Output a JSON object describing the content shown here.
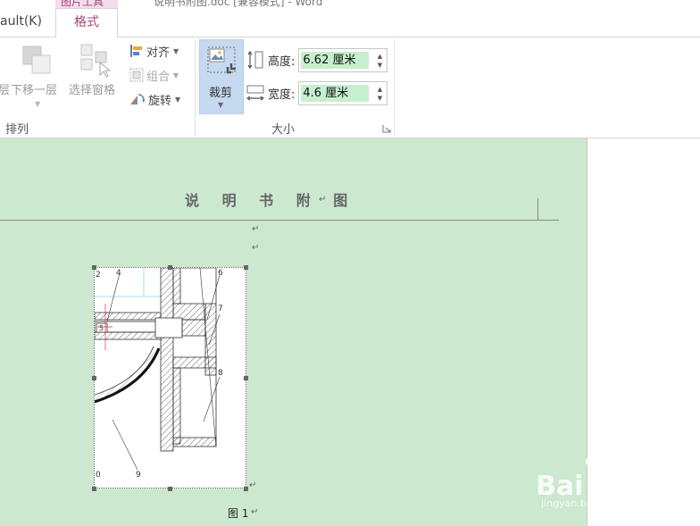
{
  "ribbon": {
    "context_tab_label": "图片工具",
    "title_fragment": "说明书附图.doc [兼容模式] - Word",
    "tabs": [
      {
        "label": "ault(K)"
      },
      {
        "label": "格式"
      }
    ],
    "arrange": {
      "group_label": "排列",
      "bring_forward_label": "层",
      "send_backward_label": "下移一层",
      "selection_pane_label": "选择窗格",
      "align_label": "对齐",
      "group_objects_label": "组合",
      "rotate_label": "旋转"
    },
    "size": {
      "group_label": "大小",
      "crop_label": "裁剪",
      "height_label": "高度:",
      "height_value": "6.62 厘米",
      "width_label": "宽度:",
      "width_value": "4.6 厘米"
    }
  },
  "document": {
    "title": "说 明 书 附 图",
    "paragraph_mark": "↵",
    "figure_caption": "图 1",
    "part_numbers": [
      "2",
      "4",
      "5",
      "6",
      "7",
      "8",
      "9",
      "0"
    ]
  },
  "watermark": {
    "brand": "Bai 经验",
    "url": "jingyan.baidu.com"
  },
  "colors": {
    "page_background": "#cce8cf",
    "accent_tab": "#a5467a",
    "crop_highlight": "#c5d9f1",
    "value_highlight": "#c6efce"
  }
}
